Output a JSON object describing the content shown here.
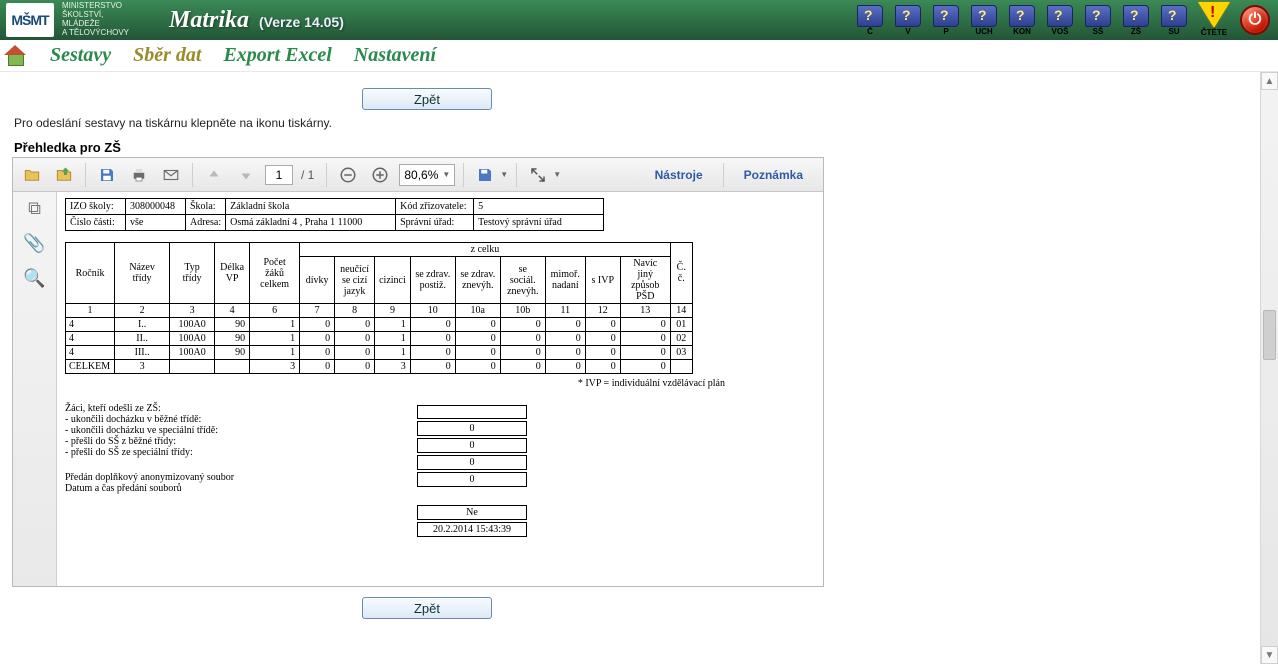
{
  "app": {
    "ministry_line1": "MINISTERSTVO",
    "ministry_line2": "ŠKOLSTVÍ,",
    "ministry_line3": "MLÁDEŽE",
    "ministry_line4": "A TĚLOVÝCHOVY",
    "logo": "MŠMT",
    "title": "Matrika",
    "version": "(Verze 14.05)"
  },
  "topicons": [
    "Č",
    "V",
    "P",
    "UCH",
    "KON",
    "VOŠ",
    "SŠ",
    "ZŠ",
    "SU"
  ],
  "topspecial": {
    "ctete": "ČTĚTE"
  },
  "menu": {
    "sestavy": "Sestavy",
    "sber": "Sběr dat",
    "export": "Export Excel",
    "nastaveni": "Nastavení"
  },
  "page": {
    "back": "Zpět",
    "hint": "Pro odeslání sestavy na tiskárnu klepněte na ikonu tiskárny.",
    "title": "Přehledka pro ZŠ"
  },
  "viewer": {
    "page_current": "1",
    "page_total": "/ 1",
    "zoom": "80,6%",
    "tab_tools": "Nástroje",
    "tab_note": "Poznámka"
  },
  "report": {
    "hdr": {
      "izo_lbl": "IZO školy:",
      "izo_val": "308000048",
      "skola_lbl": "Škola:",
      "skola_val": "Základní škola",
      "kod_lbl": "Kód zřizovatele:",
      "kod_val": "5",
      "cast_lbl": "Číslo části:",
      "cast_val": "vše",
      "adresa_lbl": "Adresa:",
      "adresa_val": "Osmá základní 4 , Praha 1 11000",
      "urad_lbl": "Správní úřad:",
      "urad_val": "Testový správní úřad"
    },
    "grid": {
      "zcelku": "z celku",
      "cols": [
        "Ročník",
        "Název třídy",
        "Typ třídy",
        "Délka VP",
        "Počet žáků celkem",
        "dívky",
        "neučící se cizí jazyk",
        "cizinci",
        "se zdrav. postiž.",
        "se zdrav. znevýh.",
        "se sociál. znevýh.",
        "mimoř. nadaní",
        "s IVP",
        "Navíc jiný způsob PŠD",
        "Č. č."
      ],
      "nums": [
        "1",
        "2",
        "3",
        "4",
        "6",
        "7",
        "8",
        "9",
        "10",
        "10a",
        "10b",
        "11",
        "12",
        "13",
        "14"
      ],
      "rows": [
        [
          "4",
          "I..",
          "100A0",
          "90",
          "1",
          "0",
          "0",
          "1",
          "0",
          "0",
          "0",
          "0",
          "0",
          "0",
          "01"
        ],
        [
          "4",
          "II..",
          "100A0",
          "90",
          "1",
          "0",
          "0",
          "1",
          "0",
          "0",
          "0",
          "0",
          "0",
          "0",
          "02"
        ],
        [
          "4",
          "III..",
          "100A0",
          "90",
          "1",
          "0",
          "0",
          "1",
          "0",
          "0",
          "0",
          "0",
          "0",
          "0",
          "03"
        ],
        [
          "CELKEM",
          "3",
          "",
          "",
          "3",
          "0",
          "0",
          "3",
          "0",
          "0",
          "0",
          "0",
          "0",
          "0",
          ""
        ]
      ]
    },
    "note": "* IVP = individuální vzdělávací plán",
    "footer": {
      "l1": "Žáci, kteří odešli ze ZŠ:",
      "l2": "- ukončili docházku v běžné třídě:",
      "l3": "- ukončili docházku ve speciální třídě:",
      "l4": "- přešli do SŠ z běžné třídy:",
      "l5": "- přešli do SŠ ze speciální třídy:",
      "l6": "Předán doplňkový anonymizovaný soubor",
      "l7": "Datum a čas předání souborů",
      "v1": "0",
      "v2": "0",
      "v3": "0",
      "v4": "0",
      "v6": "Ne",
      "v7": "20.2.2014  15:43:39"
    }
  }
}
